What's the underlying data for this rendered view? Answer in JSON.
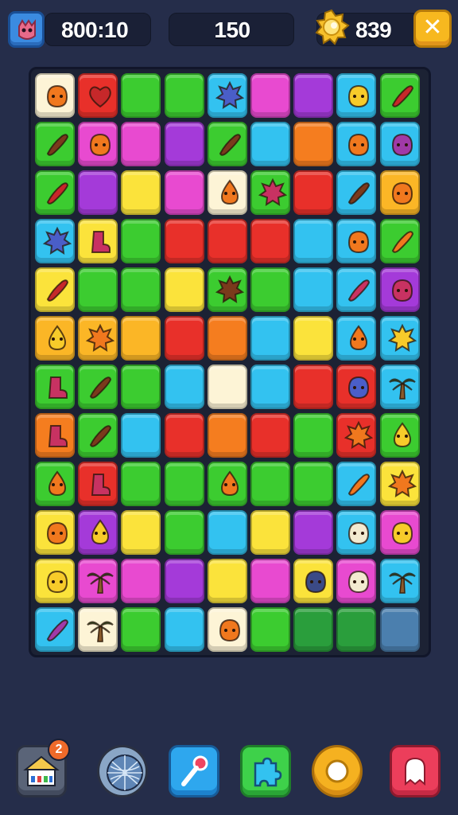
{
  "hud": {
    "timer": "800:10",
    "score": "150",
    "coins": "839",
    "close_label": "✕"
  },
  "colors": {
    "Y": "#fbe33b",
    "R": "#e8302a",
    "G": "#3ccc30",
    "DG": "#2a9e3c",
    "B": "#33c2f0",
    "P": "#e84ad0",
    "V": "#a43ad9",
    "O": "#f57d1f",
    "A": "#fbb626",
    "C": "#fdf4d6",
    "S": "#4b7fae"
  },
  "board": {
    "rows": [
      [
        {
          "c": "C",
          "i": "orange-blob-icon"
        },
        {
          "c": "R",
          "i": "red-heart-fruit-icon"
        },
        {
          "c": "G"
        },
        {
          "c": "G"
        },
        {
          "c": "B",
          "i": "blue-crystal-icon"
        },
        {
          "c": "P"
        },
        {
          "c": "V"
        },
        {
          "c": "B",
          "i": "yellow-fish-icon"
        },
        {
          "c": "G",
          "i": "red-root-icon"
        }
      ],
      [
        {
          "c": "G",
          "i": "brown-stick-icon"
        },
        {
          "c": "P",
          "i": "orange-pumpkin-icon"
        },
        {
          "c": "P"
        },
        {
          "c": "V"
        },
        {
          "c": "G",
          "i": "brown-bean-icon"
        },
        {
          "c": "B"
        },
        {
          "c": "O"
        },
        {
          "c": "B",
          "i": "orange-fish-icon"
        },
        {
          "c": "B",
          "i": "purple-slime-icon"
        }
      ],
      [
        {
          "c": "G",
          "i": "red-pepper-icon"
        },
        {
          "c": "V"
        },
        {
          "c": "Y"
        },
        {
          "c": "P"
        },
        {
          "c": "C",
          "i": "orange-carrot-icon"
        },
        {
          "c": "G",
          "i": "pink-star-icon"
        },
        {
          "c": "R"
        },
        {
          "c": "B",
          "i": "brown-horn-icon"
        },
        {
          "c": "A",
          "i": "orange-slime-icon"
        }
      ],
      [
        {
          "c": "B",
          "i": "blue-spiky-icon"
        },
        {
          "c": "Y",
          "i": "pink-boot-icon"
        },
        {
          "c": "G"
        },
        {
          "c": "R"
        },
        {
          "c": "R"
        },
        {
          "c": "R"
        },
        {
          "c": "B"
        },
        {
          "c": "B",
          "i": "orange-fish-icon"
        },
        {
          "c": "G",
          "i": "orange-sausage-icon"
        }
      ],
      [
        {
          "c": "Y",
          "i": "red-sausage-icon"
        },
        {
          "c": "G"
        },
        {
          "c": "G"
        },
        {
          "c": "Y"
        },
        {
          "c": "G",
          "i": "brown-chestnut-icon"
        },
        {
          "c": "G"
        },
        {
          "c": "B"
        },
        {
          "c": "B",
          "i": "pink-worm-icon"
        },
        {
          "c": "V",
          "i": "pink-face-icon"
        }
      ],
      [
        {
          "c": "A",
          "i": "yellow-pear-icon"
        },
        {
          "c": "A",
          "i": "orange-fuzz-icon"
        },
        {
          "c": "A"
        },
        {
          "c": "R"
        },
        {
          "c": "O"
        },
        {
          "c": "B"
        },
        {
          "c": "Y"
        },
        {
          "c": "B",
          "i": "orange-drop-icon"
        },
        {
          "c": "B",
          "i": "yellow-sun-icon"
        }
      ],
      [
        {
          "c": "G",
          "i": "pink-boot-icon"
        },
        {
          "c": "G",
          "i": "brown-stick-icon"
        },
        {
          "c": "G"
        },
        {
          "c": "B"
        },
        {
          "c": "C"
        },
        {
          "c": "B"
        },
        {
          "c": "R"
        },
        {
          "c": "R",
          "i": "blue-monster-icon"
        },
        {
          "c": "B",
          "i": "green-plant-icon"
        }
      ],
      [
        {
          "c": "O",
          "i": "pink-boot-icon"
        },
        {
          "c": "G",
          "i": "brown-wing-icon"
        },
        {
          "c": "B"
        },
        {
          "c": "R"
        },
        {
          "c": "O"
        },
        {
          "c": "R"
        },
        {
          "c": "G"
        },
        {
          "c": "R",
          "i": "orange-burst-icon"
        },
        {
          "c": "G",
          "i": "yellow-pear-icon"
        }
      ],
      [
        {
          "c": "G",
          "i": "orange-carrot-icon"
        },
        {
          "c": "R",
          "i": "pink-boot-icon"
        },
        {
          "c": "G"
        },
        {
          "c": "G"
        },
        {
          "c": "G",
          "i": "orange-carrot-icon"
        },
        {
          "c": "G"
        },
        {
          "c": "G"
        },
        {
          "c": "B",
          "i": "orange-worm-icon"
        },
        {
          "c": "Y",
          "i": "orange-sun-icon"
        }
      ],
      [
        {
          "c": "Y",
          "i": "orange-pumpkin-icon"
        },
        {
          "c": "V",
          "i": "yellow-cup-icon"
        },
        {
          "c": "Y"
        },
        {
          "c": "G"
        },
        {
          "c": "B"
        },
        {
          "c": "Y"
        },
        {
          "c": "V"
        },
        {
          "c": "B",
          "i": "cream-cat-icon"
        },
        {
          "c": "P",
          "i": "yellow-slime-icon"
        }
      ],
      [
        {
          "c": "Y",
          "i": "yellow-splat-icon"
        },
        {
          "c": "P",
          "i": "palm-tree-icon"
        },
        {
          "c": "P"
        },
        {
          "c": "V"
        },
        {
          "c": "Y"
        },
        {
          "c": "P"
        },
        {
          "c": "Y",
          "i": "navy-bird-icon"
        },
        {
          "c": "P",
          "i": "cream-blob-icon"
        },
        {
          "c": "B",
          "i": "green-tree-icon"
        }
      ],
      [
        {
          "c": "B",
          "i": "purple-sausage-icon"
        },
        {
          "c": "C",
          "i": "palm-tree-icon"
        },
        {
          "c": "G"
        },
        {
          "c": "B"
        },
        {
          "c": "C",
          "i": "orange-blob-icon"
        },
        {
          "c": "G"
        },
        {
          "c": "DG"
        },
        {
          "c": "DG"
        },
        {
          "c": "S"
        }
      ]
    ]
  },
  "bottom_bar": {
    "items": [
      {
        "name": "house-booster-icon",
        "badge": "2"
      },
      {
        "name": "globe-booster-icon"
      },
      {
        "name": "pin-booster-icon"
      },
      {
        "name": "puzzle-booster-icon"
      },
      {
        "name": "coin-booster-icon"
      },
      {
        "name": "ghost-booster-icon"
      }
    ]
  }
}
